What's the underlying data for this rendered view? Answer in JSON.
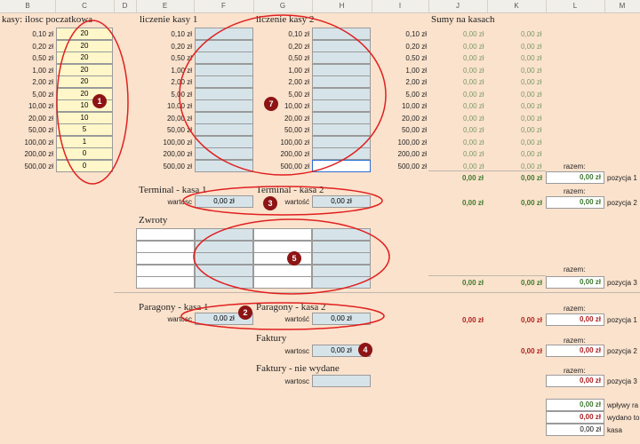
{
  "columns": [
    "B",
    "C",
    "D",
    "E",
    "F",
    "G",
    "H",
    "I",
    "J",
    "K",
    "L",
    "M"
  ],
  "section_titles": {
    "initial": "kasy: ilosc poczatkowa",
    "count1": "liczenie kasy 1",
    "count2": "liczenie kasy 2",
    "sums": "Sumy na kasach",
    "terminal1": "Terminal - kasa 1",
    "terminal2": "Terminal - kasa 2",
    "returns": "Zwroty",
    "receipts1": "Paragony - kasa 1",
    "receipts2": "Paragony - kasa 2",
    "invoices": "Faktury",
    "invoices_unissued": "Faktury - nie wydane"
  },
  "denominations": [
    "0,10 zł",
    "0,20 zł",
    "0,50 zł",
    "1,00 zł",
    "2,00 zł",
    "5,00 zł",
    "10,00 zł",
    "20,00 zł",
    "50,00 zł",
    "100,00 zł",
    "200,00 zł",
    "500,00 zł"
  ],
  "initial_counts": [
    "20",
    "20",
    "20",
    "20",
    "20",
    "20",
    "10",
    "10",
    "5",
    "1",
    "0",
    "0"
  ],
  "sums_col_j": [
    "0,00 zł",
    "0,00 zł",
    "0,00 zł",
    "0,00 zł",
    "0,00 zł",
    "0,00 zł",
    "0,00 zł",
    "0,00 zł",
    "0,00 zł",
    "0,00 zł",
    "0,00 zł",
    "0,00 zł"
  ],
  "sums_col_k": [
    "0,00 zł",
    "0,00 zł",
    "0,00 zł",
    "0,00 zł",
    "0,00 zł",
    "0,00 zł",
    "0,00 zł",
    "0,00 zł",
    "0,00 zł",
    "0,00 zł",
    "0,00 zł",
    "0,00 zł"
  ],
  "labels": {
    "value": "wartość",
    "value_short": "wartosc",
    "razem": "razem:",
    "pozycja1": "pozycja 1",
    "pozycja2": "pozycja 2",
    "pozycja3": "pozycja 3",
    "wplywy": "wpływy ra",
    "wydano": "wydano to",
    "kasa": "kasa"
  },
  "values": {
    "zero": "0,00 zł",
    "terminal1": "0,00 zł",
    "terminal2": "0,00 zł",
    "receipts1": "0,00 zł",
    "receipts2": "0,00 zł",
    "invoices": "0,00 zł"
  },
  "badges": [
    "1",
    "2",
    "3",
    "4",
    "5",
    "7"
  ],
  "colors": {
    "background": "#fbe2cc",
    "input_blue": "#d6e4ea",
    "input_yellow": "#fff7c9",
    "green": "#3d7a2e",
    "red": "#b02020",
    "annotation": "#e02020"
  }
}
